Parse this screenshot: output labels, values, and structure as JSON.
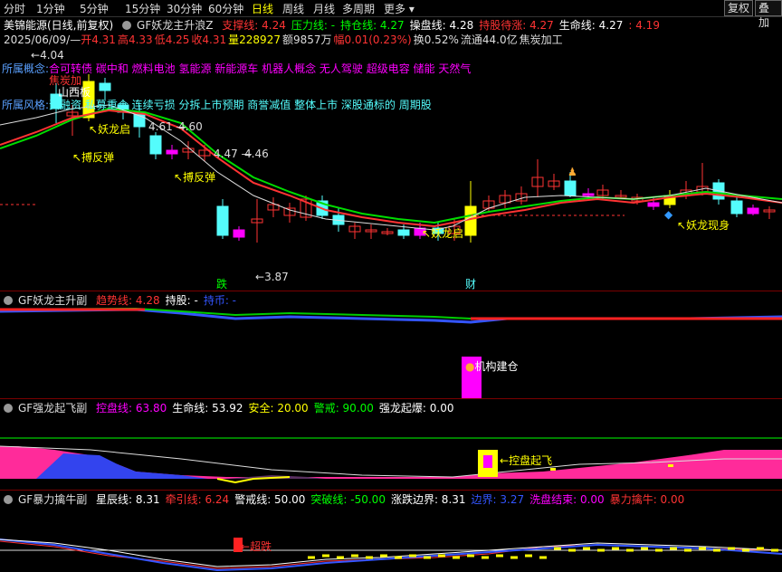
{
  "toolbar": {
    "periods": [
      "分时",
      "1分钟",
      "5分钟",
      "15分钟",
      "30分钟",
      "60分钟",
      "日线",
      "周线",
      "月线",
      "多周期",
      "更多"
    ],
    "active": "日线",
    "restore": "复权",
    "overlay": "叠加"
  },
  "main": {
    "stock_title": "美锦能源(日线,前复权)",
    "indicator": "GF妖龙主升浪Z",
    "legend": [
      {
        "label": "支撑线:",
        "value": "4.24",
        "color": "#ff3333"
      },
      {
        "label": "压力线:",
        "value": "-",
        "color": "#00ff00"
      },
      {
        "label": "持仓线:",
        "value": "4.27",
        "color": "#00ff00"
      },
      {
        "label": "操盘线:",
        "value": "4.28",
        "color": "#ffffff"
      },
      {
        "label": "持股待涨:",
        "value": "4.27",
        "color": "#ff3333"
      },
      {
        "label": "生命线:",
        "value": "4.27",
        "color": "#ffffff"
      },
      {
        "label": ":",
        "value": "4.19",
        "color": "#ff3333"
      }
    ],
    "info_line": {
      "date": "2025/06/09/—",
      "open": "开4.31",
      "high": "高4.33",
      "low": "低4.25",
      "close": "收4.31",
      "volume": "量228927",
      "amount": "额9857万",
      "change": "幅0.01(0.23%)",
      "turnover": "换0.52%",
      "float": "流通44.0亿",
      "industry": "焦炭加工"
    },
    "concept_label": "所属概念:",
    "concepts": "合可转债 碳中和 燃料电池 氢能源 新能源车 机器人概念 无人驾驶 超级电容 储能 天然气",
    "overlay_text_1": "焦炭加",
    "overlay_text_2": "山西板",
    "style_label": "所属风格:",
    "styles": "资融资 私募重仓 连续亏损 分拆上市预期 商誉减值 整体上市 深股通标的 周期股",
    "price_high": "4.04",
    "price_low": "3.87",
    "price_a": "4.61",
    "price_b": "4.60",
    "price_c": "4.47",
    "price_d": "4.46",
    "tag_yaolong_start": "妖龙启",
    "tag_rebound_1": "搏反弹",
    "tag_rebound_2": "搏反弹",
    "tag_start_2": "妖龙启",
    "tag_appear": "妖龙现身",
    "tag_fall": "跌",
    "tag_fin": "财",
    "colors": {
      "up": "#ff3333",
      "down": "#54fcfc",
      "yellow": "#ffff00",
      "magenta": "#ff00ff"
    }
  },
  "sub1": {
    "indicator": "GF妖龙主升副",
    "legend": [
      {
        "label": "趋势线:",
        "value": "4.28",
        "color": "#ff3333"
      },
      {
        "label": "持股:",
        "value": "-",
        "color": "#ffffff"
      },
      {
        "label": "持币:",
        "value": "-",
        "color": "#3355ff"
      }
    ],
    "tag_build": "机构建仓"
  },
  "sub2": {
    "indicator": "GF强龙起飞副",
    "legend": [
      {
        "label": "控盘线:",
        "value": "63.80",
        "color": "#ff00ff"
      },
      {
        "label": "生命线:",
        "value": "53.92",
        "color": "#ffffff"
      },
      {
        "label": "安全:",
        "value": "20.00",
        "color": "#ffff00"
      },
      {
        "label": "警戒:",
        "value": "90.00",
        "color": "#00ff00"
      },
      {
        "label": "强龙起爆:",
        "value": "0.00",
        "color": "#ffffff"
      }
    ],
    "tag_control": "控盘起飞"
  },
  "sub3": {
    "indicator": "GF暴力擒牛副",
    "legend": [
      {
        "label": "星辰线:",
        "value": "8.31",
        "color": "#ffffff"
      },
      {
        "label": "牵引线:",
        "value": "6.24",
        "color": "#ff3333"
      },
      {
        "label": "警戒线:",
        "value": "50.00",
        "color": "#ffffff"
      },
      {
        "label": "突破线:",
        "value": "-50.00",
        "color": "#00ff00"
      },
      {
        "label": "涨跌边界:",
        "value": "8.31",
        "color": "#ffffff"
      },
      {
        "label": "边界:",
        "value": "3.27",
        "color": "#3355ff"
      },
      {
        "label": "洗盘结束:",
        "value": "0.00",
        "color": "#ff00ff"
      },
      {
        "label": "暴力擒牛:",
        "value": "0.00",
        "color": "#ff3333"
      }
    ],
    "tag_super": "超跌"
  }
}
